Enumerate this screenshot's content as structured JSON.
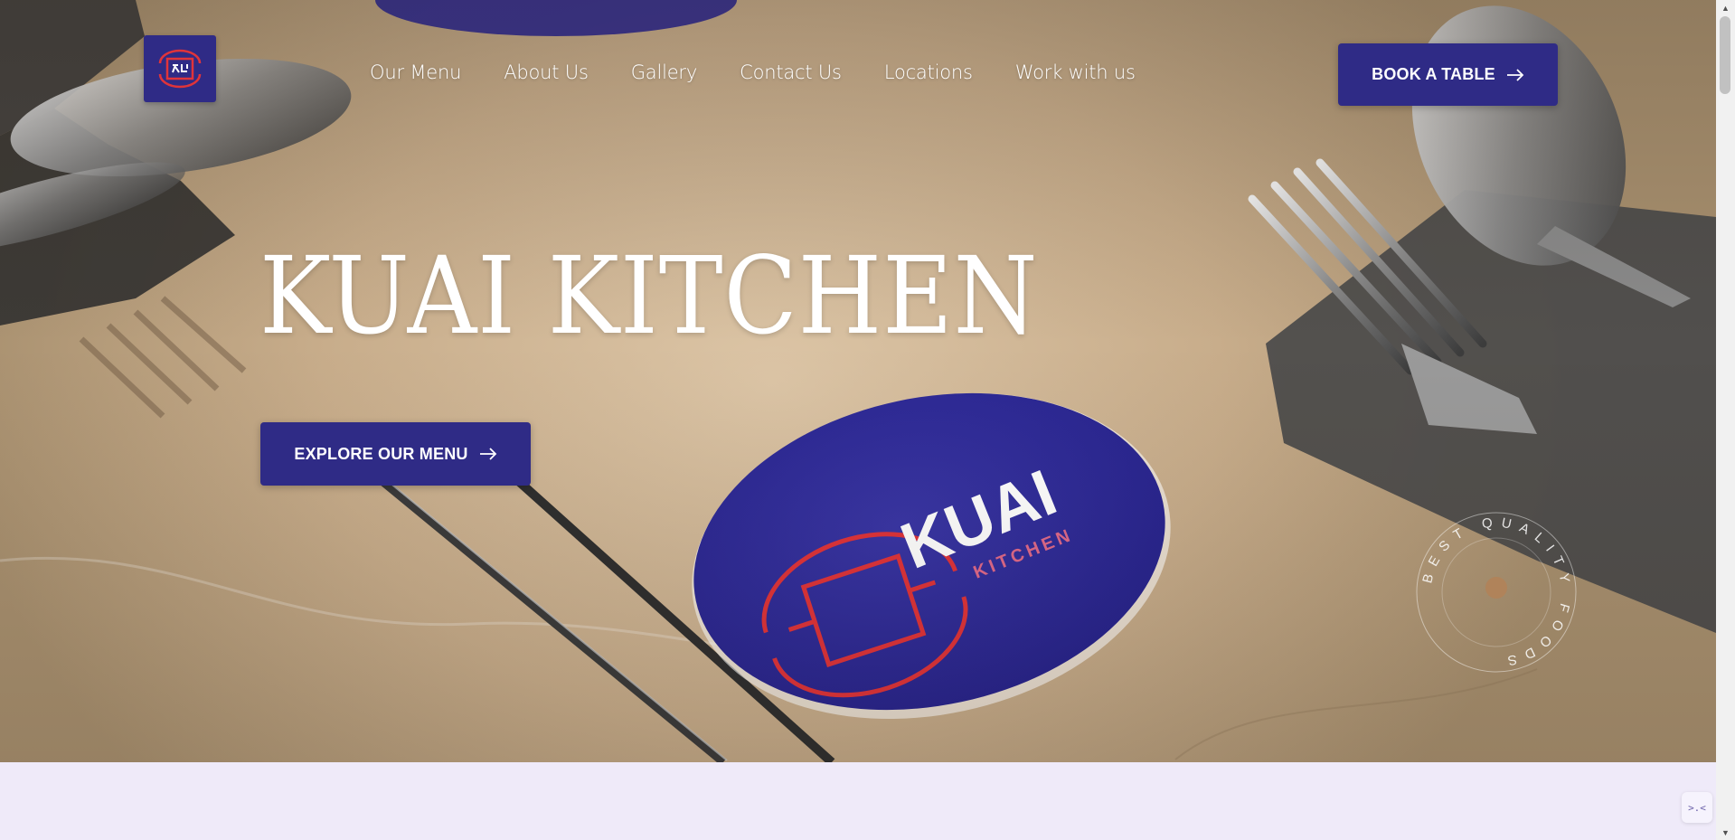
{
  "brand": {
    "logo_icon": "kuai-logo-icon",
    "accent": "#2f2b86",
    "logo_red": "#e0343a"
  },
  "nav": {
    "items": [
      {
        "label": "Our Menu"
      },
      {
        "label": "About Us"
      },
      {
        "label": "Gallery"
      },
      {
        "label": "Contact Us"
      },
      {
        "label": "Locations"
      },
      {
        "label": "Work with us"
      }
    ]
  },
  "header": {
    "book_label": "BOOK A TABLE",
    "book_icon": "arrow-right-icon"
  },
  "hero": {
    "title": "KUAI KITCHEN",
    "explore_label": "EXPLORE OUR MENU",
    "explore_icon": "arrow-right-icon",
    "coaster_text": "KUAI",
    "coaster_subtext": "KITCHEN",
    "badge_text": "BEST QUALITY FOODS"
  },
  "widget": {
    "label": ">.<"
  }
}
